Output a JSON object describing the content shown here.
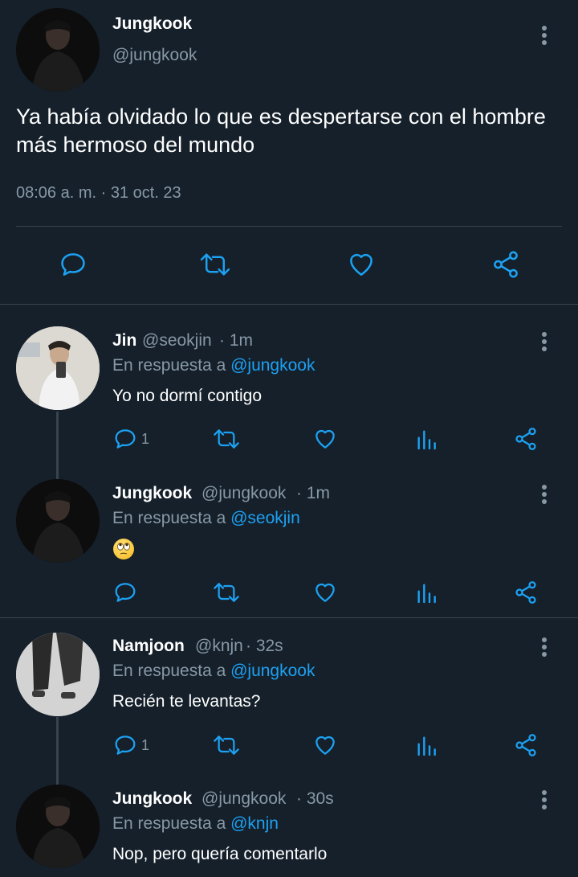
{
  "main_tweet": {
    "name": "Jungkook",
    "handle": "@jungkook",
    "text": "Ya había olvidado lo que es despertarse con el hombre más hermoso del mundo",
    "timestamp": "08:06 a. m. · 31 oct. 23"
  },
  "replies": [
    {
      "name": "Jin",
      "handle": "@seokjin",
      "time": "· 1m",
      "reply_prefix": "En respuesta a ",
      "reply_to": "@jungkook",
      "text": "Yo no dormí contigo",
      "reply_count": "1"
    },
    {
      "name": "Jungkook",
      "handle": "@jungkook",
      "time": "· 1m",
      "reply_prefix": "En respuesta a ",
      "reply_to": "@seokjin",
      "text": "",
      "emoji": "face-with-rolling-eyes",
      "reply_count": ""
    },
    {
      "name": "Namjoon",
      "handle": "@knjn",
      "time": "· 32s",
      "reply_prefix": "En respuesta a ",
      "reply_to": "@jungkook",
      "text": "Recién te levantas?",
      "reply_count": "1"
    },
    {
      "name": "Jungkook",
      "handle": "@jungkook",
      "time": "· 30s",
      "reply_prefix": "En respuesta a ",
      "reply_to": "@knjn",
      "text": "Nop, pero quería comentarlo",
      "reply_count": ""
    }
  ],
  "icons": {
    "reply": "reply-icon",
    "retweet": "retweet-icon",
    "like": "heart-icon",
    "analytics": "analytics-icon",
    "share": "share-icon",
    "more": "more-vertical-icon"
  },
  "colors": {
    "background": "#15202b",
    "accent": "#1da1f2",
    "secondary_text": "#8899a6",
    "divider": "#38444d"
  }
}
